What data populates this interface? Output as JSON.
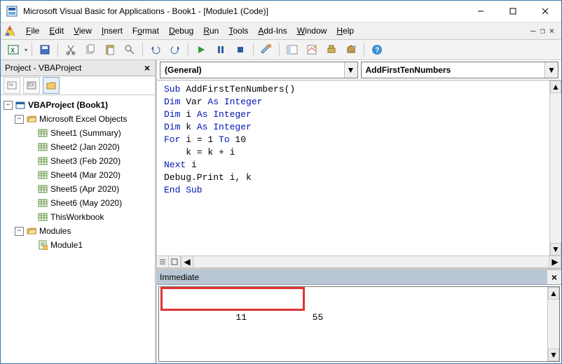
{
  "window": {
    "title": "Microsoft Visual Basic for Applications - Book1 - [Module1 (Code)]"
  },
  "menu": {
    "file": "File",
    "edit": "Edit",
    "view": "View",
    "insert": "Insert",
    "format": "Format",
    "debug": "Debug",
    "run": "Run",
    "tools": "Tools",
    "addins": "Add-Ins",
    "window": "Window",
    "help": "Help"
  },
  "project": {
    "pane_title": "Project - VBAProject",
    "root": "VBAProject (Book1)",
    "folder_excel": "Microsoft Excel Objects",
    "sheets": [
      "Sheet1 (Summary)",
      "Sheet2 (Jan 2020)",
      "Sheet3 (Feb 2020)",
      "Sheet4 (Mar 2020)",
      "Sheet5 (Apr 2020)",
      "Sheet6 (May 2020)"
    ],
    "thisworkbook": "ThisWorkbook",
    "folder_modules": "Modules",
    "module1": "Module1"
  },
  "dropdowns": {
    "left": "(General)",
    "right": "AddFirstTenNumbers"
  },
  "code": {
    "lines": [
      {
        "t": [
          {
            "k": "kw",
            "s": "Sub"
          },
          {
            "k": "",
            "s": " AddFirstTenNumbers()"
          }
        ]
      },
      {
        "t": [
          {
            "k": "kw",
            "s": "Dim"
          },
          {
            "k": "",
            "s": " Var "
          },
          {
            "k": "kw",
            "s": "As Integer"
          }
        ]
      },
      {
        "t": [
          {
            "k": "kw",
            "s": "Dim"
          },
          {
            "k": "",
            "s": " i "
          },
          {
            "k": "kw",
            "s": "As Integer"
          }
        ]
      },
      {
        "t": [
          {
            "k": "kw",
            "s": "Dim"
          },
          {
            "k": "",
            "s": " k "
          },
          {
            "k": "kw",
            "s": "As Integer"
          }
        ]
      },
      {
        "t": [
          {
            "k": "kw",
            "s": "For"
          },
          {
            "k": "",
            "s": " i = 1 "
          },
          {
            "k": "kw",
            "s": "To"
          },
          {
            "k": "",
            "s": " 10"
          }
        ]
      },
      {
        "t": [
          {
            "k": "",
            "s": "    k = k + i"
          }
        ]
      },
      {
        "t": [
          {
            "k": "kw",
            "s": "Next"
          },
          {
            "k": "",
            "s": " i"
          }
        ]
      },
      {
        "t": [
          {
            "k": "",
            "s": "Debug.Print i, k"
          }
        ]
      },
      {
        "t": [
          {
            "k": "kw",
            "s": "End Sub"
          }
        ]
      }
    ]
  },
  "immediate": {
    "title": "Immediate",
    "output": " 11            55"
  }
}
